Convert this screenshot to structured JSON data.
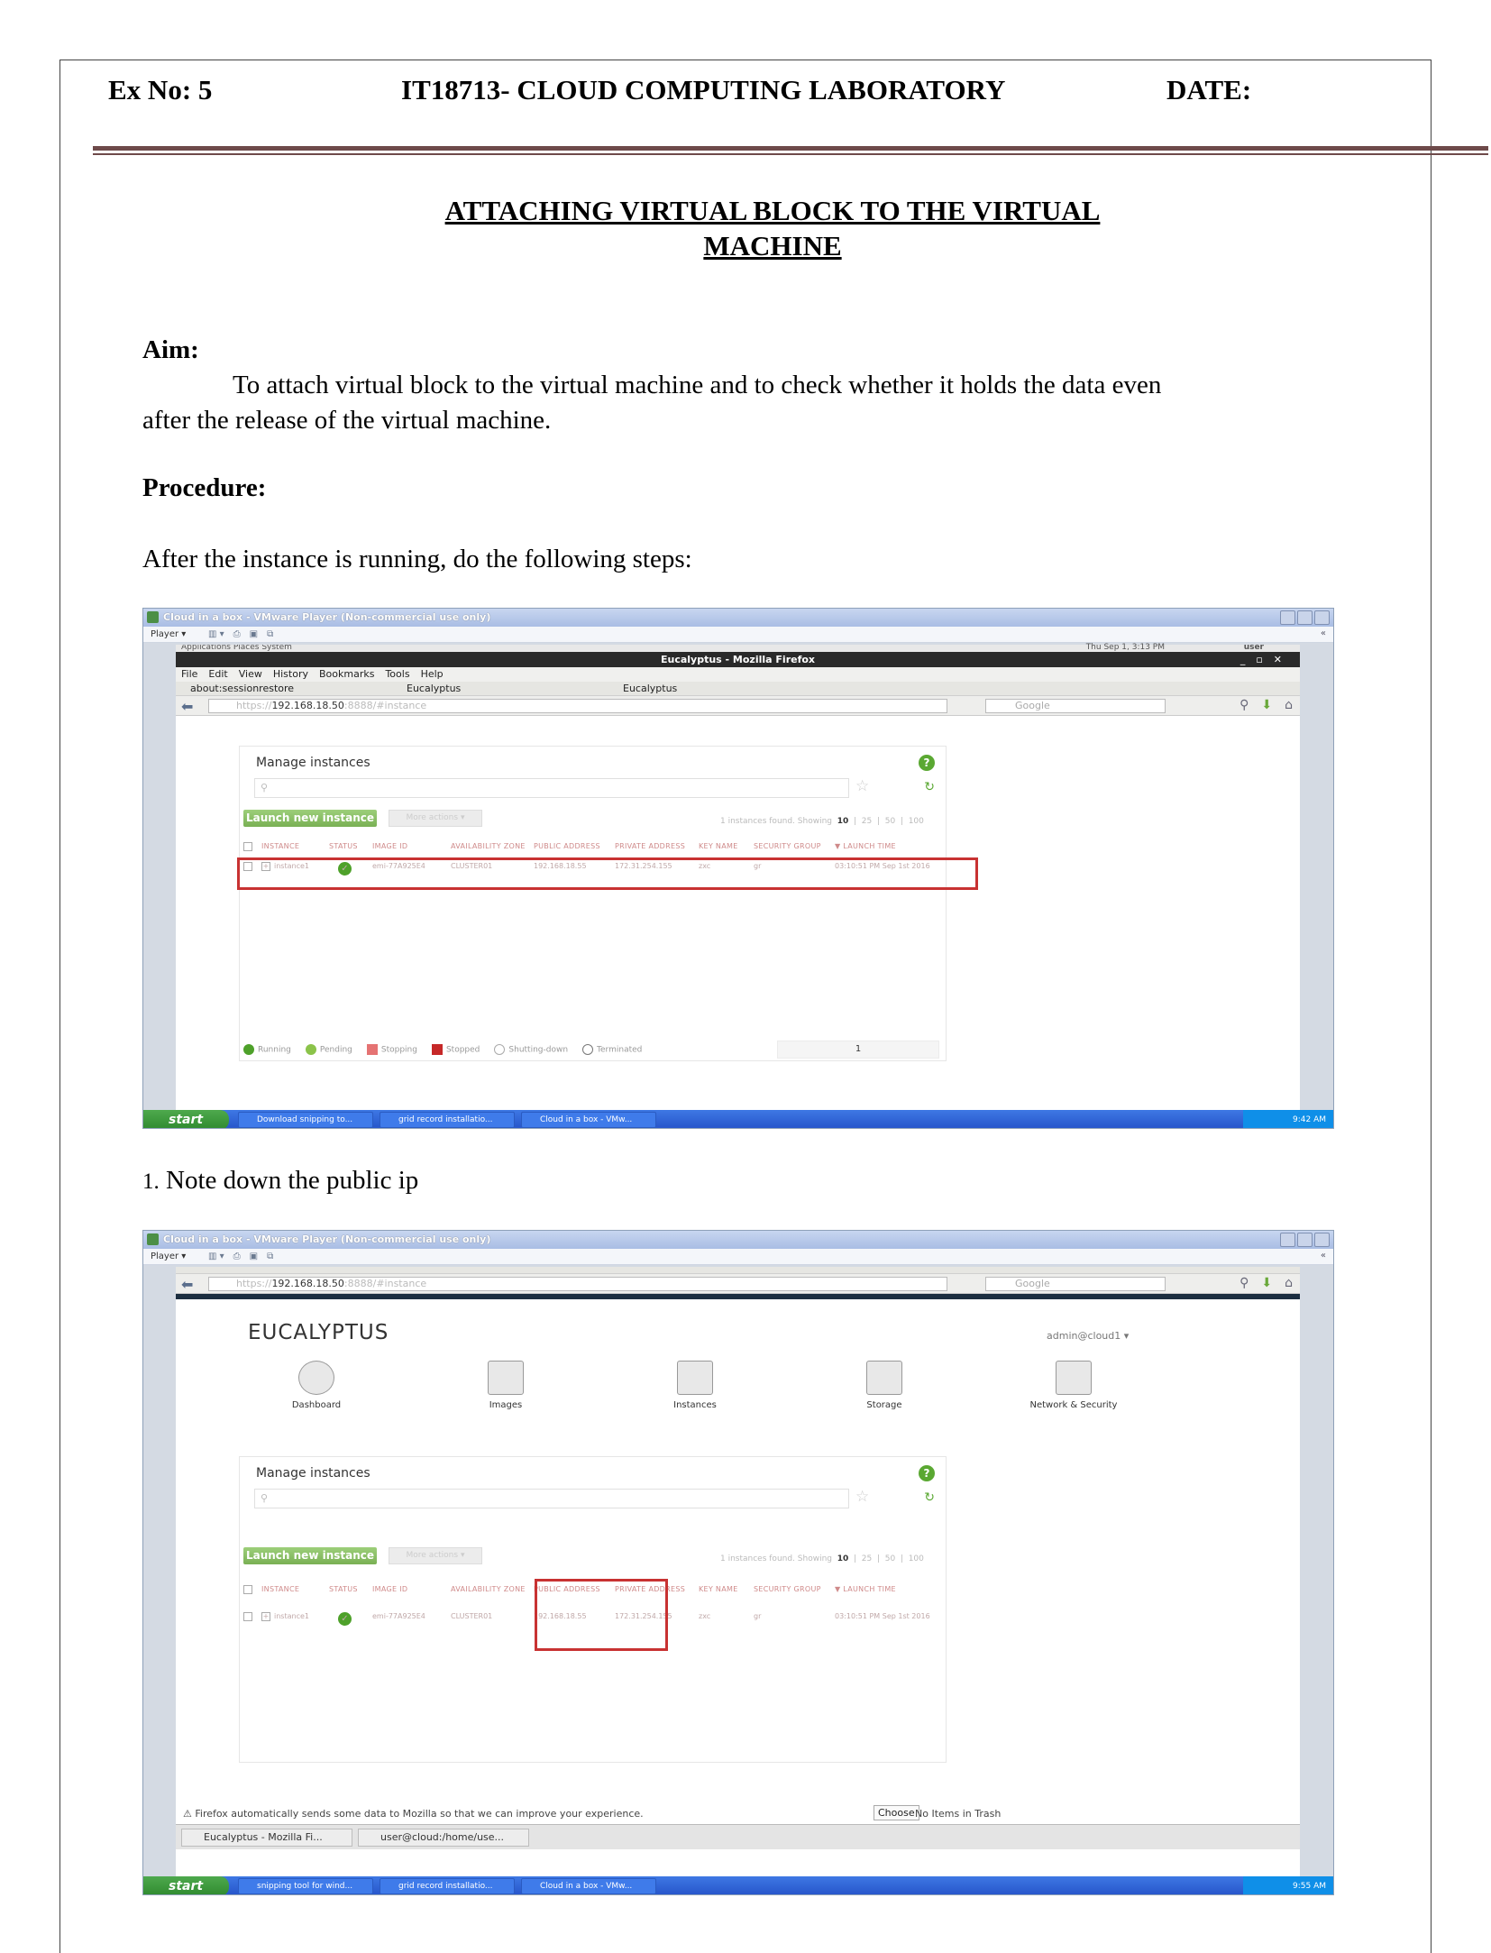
{
  "header": {
    "ex_no": "Ex No: 5",
    "course": "IT18713- CLOUD COMPUTING LABORATORY",
    "date": "DATE:"
  },
  "title": {
    "line1": "ATTACHING VIRTUAL BLOCK TO THE VIRTUAL",
    "line2": "MACHINE"
  },
  "aim": {
    "heading": "Aim:",
    "text_line1": "To attach virtual block to the virtual machine and to check whether it holds the data even",
    "text_line2": "after the release of the virtual machine."
  },
  "procedure": {
    "heading": "Procedure:",
    "intro": "After the instance is running, do the following steps:",
    "step1_num": "1.",
    "step1_text": " Note down the public ip"
  },
  "vmware": {
    "title": "Cloud in a box - VMware Player (Non-commercial use only)",
    "player_label": "Player ▾",
    "collapse": "«"
  },
  "firefox": {
    "window_title": "Eucalyptus - Mozilla Firefox",
    "gnome_menu": "Applications   Places   System",
    "gnome_clock": "Thu Sep  1,  3:13 PM",
    "gnome_user": "user",
    "menu": [
      "File",
      "Edit",
      "View",
      "History",
      "Bookmarks",
      "Tools",
      "Help"
    ],
    "tab1": "about:sessionrestore",
    "tab2": "Eucalyptus",
    "tab3": "Eucalyptus",
    "url_scheme": "https://",
    "url_host": "192.168.18.50",
    "url_rest": ":8888/#instance",
    "search_placeholder": "Google"
  },
  "manage": {
    "title": "Manage instances",
    "help": "?",
    "launch_label": "Launch new instance",
    "more_label": "More actions ▾",
    "found": "1 instances found. Showing",
    "page_sizes": [
      "10",
      "|",
      "25",
      "|",
      "50",
      "|",
      "100"
    ],
    "headers": [
      "INSTANCE",
      "STATUS",
      "IMAGE ID",
      "AVAILABILITY ZONE",
      "PUBLIC ADDRESS",
      "PRIVATE ADDRESS",
      "KEY NAME",
      "SECURITY GROUP",
      "▼ LAUNCH TIME"
    ],
    "row": {
      "instance": "instance1",
      "image_id": "emi-77A925E4",
      "zone": "CLUSTER01",
      "public_address": "192.168.18.55",
      "private_address": "172.31.254.155",
      "key_name": "zxc",
      "security_group": "gr",
      "launch_time": "03:10:51 PM Sep 1st 2016"
    },
    "legend": [
      "Running",
      "Pending",
      "Stopping",
      "Stopped",
      "Shutting-down",
      "Terminated"
    ],
    "page_current": "1"
  },
  "eucalyptus": {
    "logo": "EUCALYPTUS",
    "user": "admin@cloud1 ▾",
    "nav": [
      "Dashboard",
      "Images",
      "Instances",
      "Storage",
      "Network & Security"
    ]
  },
  "taskbar1": {
    "start": "start",
    "items": [
      "Download snipping to...",
      "grid record installatio...",
      "Cloud in a box - VMw..."
    ],
    "clock": "9:42 AM"
  },
  "taskbar2": {
    "start": "start",
    "items": [
      "snipping tool for wind...",
      "grid record installatio...",
      "Cloud in a box - VMw..."
    ],
    "clock": "9:55 AM"
  },
  "shot2": {
    "ff_note": "Firefox automatically sends some data to Mozilla so that we can improve your experience.",
    "choose": "Choose",
    "trash": "No Items in Trash",
    "gnome_tasks": [
      "Eucalyptus - Mozilla Fi...",
      "user@cloud:/home/use..."
    ]
  }
}
